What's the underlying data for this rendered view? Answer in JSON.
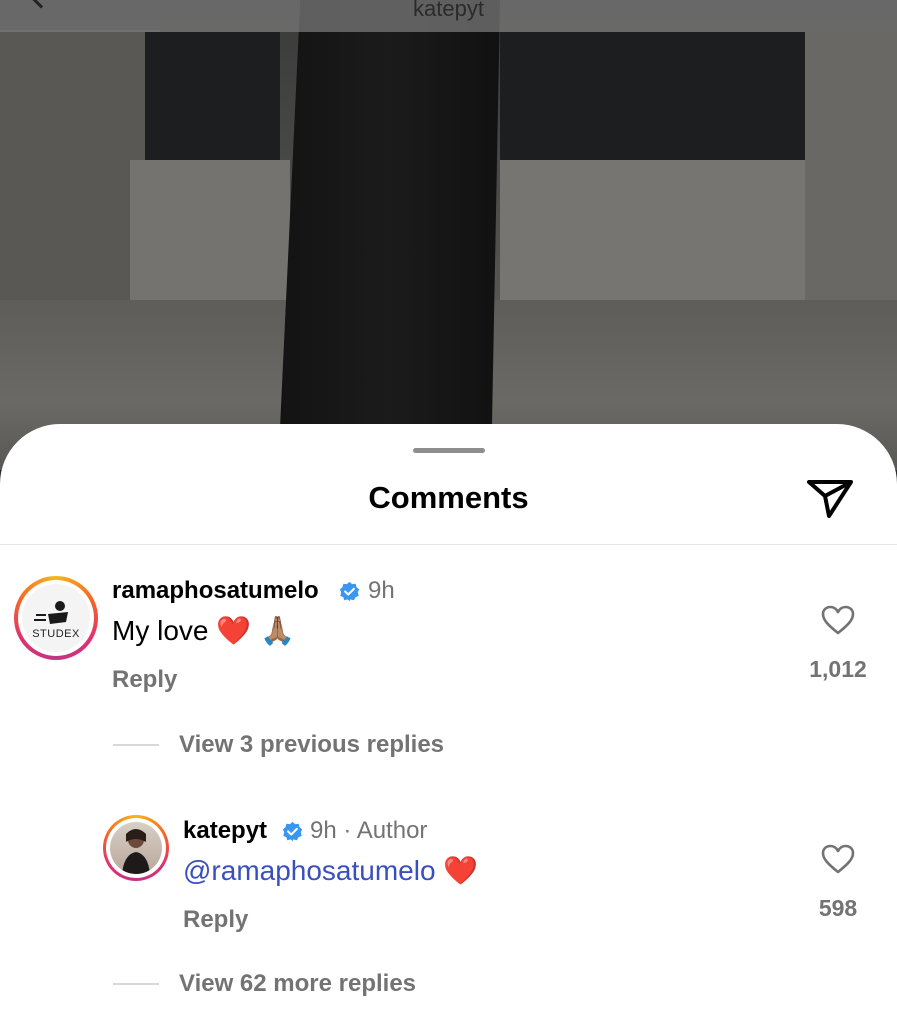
{
  "header": {
    "title": "katepyt"
  },
  "sheet": {
    "title": "Comments"
  },
  "comments": [
    {
      "username": "ramaphosatumelo",
      "verified": true,
      "time": "9h",
      "text": "My love",
      "emoji": "❤️ 🙏🏽",
      "reply_label": "Reply",
      "like_count": "1,012",
      "avatar_label": "STUDEX",
      "view_replies": "View 3 previous replies"
    },
    {
      "username": "katepyt",
      "verified": true,
      "time": "9h · Author",
      "mention": "@ramaphosatumelo",
      "emoji": "❤️",
      "reply_label": "Reply",
      "like_count": "598",
      "view_replies": "View 62 more replies"
    }
  ],
  "colors": {
    "accent": "#3897f0",
    "mention": "#3a4fbf",
    "muted": "#737373",
    "heart": "#e0202a"
  }
}
